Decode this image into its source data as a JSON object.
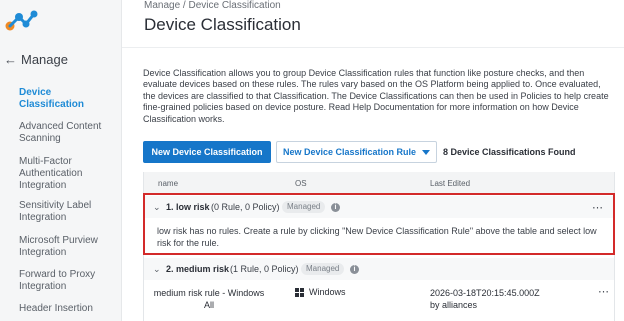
{
  "sidebar": {
    "back_label": "Manage",
    "items": [
      {
        "label": "Device Classification",
        "active": true
      },
      {
        "label": "Advanced Content Scanning",
        "active": false
      },
      {
        "label": "Multi-Factor Authentication Integration",
        "active": false
      },
      {
        "label": "Sensitivity Label Integration",
        "active": false
      },
      {
        "label": "Microsoft Purview Integration",
        "active": false
      },
      {
        "label": "Forward to Proxy Integration",
        "active": false
      },
      {
        "label": "Header Insertion",
        "active": false
      }
    ]
  },
  "header": {
    "breadcrumb": "Manage / Device Classification",
    "title": "Device Classification"
  },
  "description": "Device Classification allows you to group Device Classification rules that function like posture checks, and then evaluate devices based on these rules. The rules vary based on the OS Platform being applied to. Once evaluated, the devices are classified to that Classification. The Device Classifications can then be used in Policies to help create fine-grained policies based on device posture. Read Help Documentation for more information on how Device Classification works.",
  "toolbar": {
    "new_classification_label": "New Device Classification",
    "new_rule_label": "New Device Classification Rule",
    "found_count": "8 Device Classifications Found"
  },
  "table": {
    "columns": [
      "name",
      "OS",
      "Last Edited"
    ],
    "groups": [
      {
        "name": "1. low risk",
        "counts": "(0 Rule, 0 Policy)",
        "badge": "Managed",
        "empty_message": "low risk has no rules. Create a rule by clicking \"New Device Classification Rule\" above the table and select low risk for the rule."
      },
      {
        "name": "2. medium risk",
        "counts": "(1 Rule, 0 Policy)",
        "badge": "Managed",
        "rules": [
          {
            "name": "medium risk rule - Windows All",
            "os": "Windows",
            "last_edited": "2026-03-18T20:15:45.000Z",
            "edited_by": "by alliances"
          }
        ]
      }
    ],
    "kebab": "⋯"
  },
  "colors": {
    "accent": "#1676c9",
    "active_nav": "#1f8bd6",
    "highlight": "#d32a2a"
  },
  "icons": [
    "logo-icon",
    "back-arrow-icon",
    "chevron-down-icon",
    "info-icon",
    "kebab-menu-icon",
    "windows-icon",
    "caret-down-icon"
  ]
}
